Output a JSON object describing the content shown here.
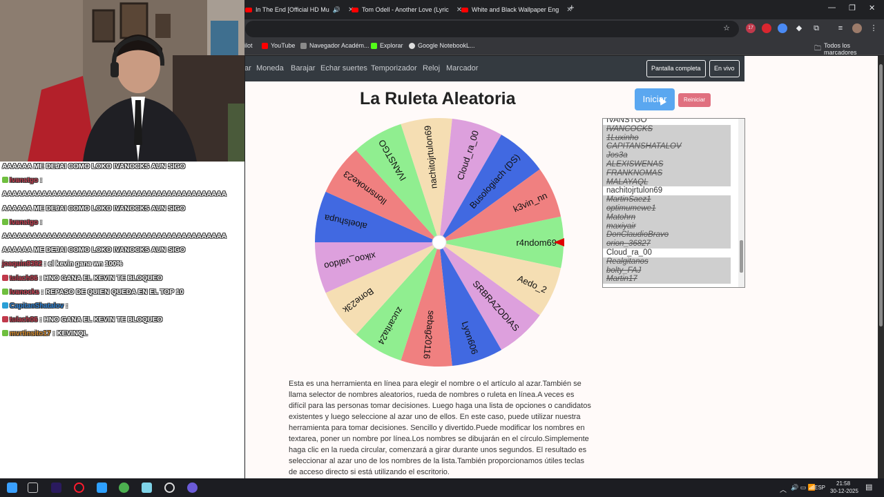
{
  "browser": {
    "tabs": [
      {
        "title": "In The End [Official HD Mu"
      },
      {
        "title": "Tom Odell - Another Love (Lyric"
      },
      {
        "title": "White and Black Wallpaper Eng"
      }
    ],
    "new_tab": "+",
    "window_controls": {
      "minimize": "—",
      "restore": "❐",
      "close": "✕"
    },
    "extension_badge": "17",
    "bookmarks": [
      {
        "label": "ilot"
      },
      {
        "label": "YouTube"
      },
      {
        "label": "Navegador Académ..."
      },
      {
        "label": "Explorar"
      },
      {
        "label": "Google NotebookL..."
      }
    ],
    "all_bookmarks": "Todos los marcadores"
  },
  "navbar": {
    "links": [
      "ar",
      "Moneda",
      "Barajar",
      "Echar suertes",
      "Temporizador",
      "Reloj",
      "Marcador"
    ],
    "fullscreen": "Pantalla completa",
    "live": "En vivo"
  },
  "page": {
    "title": "La Ruleta Aleatoria",
    "start_label": "Iniciar",
    "reset_label": "Reiniciar",
    "description": "Esta es una herramienta en línea para elegir el nombre o el artículo al azar.También se llama selector de nombres aleatorios, rueda de nombres o ruleta en línea.A veces es difícil para las personas tomar decisiones. Luego haga una lista de opciones o candidatos existentes y luego seleccione al azar uno de ellos. En este caso, puede utilizar nuestra herramienta para tomar decisiones. Sencillo y divertido.Puede modificar los nombres en textarea, poner un nombre por línea.Los nombres se dibujarán en el círculo.Simplemente haga clic en la rueda circular, comenzará a girar durante unos segundos. El resultado es seleccionar al azar uno de los nombres de la lista.También proporcionamos útiles teclas de acceso directo si está utilizando el escritorio."
  },
  "wheel": {
    "segments": [
      {
        "name": "r4ndom69",
        "color": "#90ee90"
      },
      {
        "name": "Aedo_2",
        "color": "#f5deb3"
      },
      {
        "name": "SRBRAZODIAS",
        "color": "#dda0dd"
      },
      {
        "name": "Lyon606",
        "color": "#4169e1"
      },
      {
        "name": "sebag20116",
        "color": "#f08080"
      },
      {
        "name": "zucarita24",
        "color": "#90ee90"
      },
      {
        "name": "Bone23k",
        "color": "#f5deb3"
      },
      {
        "name": "xikoo_valdoo",
        "color": "#dda0dd"
      },
      {
        "name": "aloelshupa",
        "color": "#4169e1"
      },
      {
        "name": "Ilonsmoke23",
        "color": "#f08080"
      },
      {
        "name": "IVANSTGO",
        "color": "#90ee90"
      },
      {
        "name": "nachitojrtulon69",
        "color": "#f5deb3"
      },
      {
        "name": "Cloud_ra_00",
        "color": "#dda0dd"
      },
      {
        "name": "Busologiach (DS)",
        "color": "#4169e1"
      },
      {
        "name": "k3vin_nn",
        "color": "#f08080"
      }
    ],
    "pointer_color": "#e00000"
  },
  "names_list": [
    {
      "text": "IVANSTGO",
      "off": false
    },
    {
      "text": "IVANCOCKS",
      "off": true
    },
    {
      "text": "1Luxinho",
      "off": true
    },
    {
      "text": "CAPITANSHATALOV",
      "off": true
    },
    {
      "text": "Jos3a",
      "off": true
    },
    {
      "text": "ALEXISWENAS",
      "off": true
    },
    {
      "text": "FRANKNOMAS",
      "off": true
    },
    {
      "text": "MALAYAQL",
      "off": true
    },
    {
      "text": "nachitojrtulon69",
      "off": false
    },
    {
      "text": "MartinSaez1",
      "off": true
    },
    {
      "text": "optimumewe1",
      "off": true
    },
    {
      "text": "Matohrn",
      "off": true
    },
    {
      "text": "maxiyair",
      "off": true
    },
    {
      "text": "DonClaudioBravo",
      "off": true
    },
    {
      "text": "orion_36827",
      "off": true
    },
    {
      "text": "Cloud_ra_00",
      "off": false
    },
    {
      "text": "Realgitanos",
      "off": true
    },
    {
      "text": "bolty_FAJ",
      "off": true
    },
    {
      "text": "Martin17",
      "off": true
    }
  ],
  "chat": [
    {
      "user": "",
      "text": "AAAAAA ME DEJAI COMO LOKO IVANOCKS AUN SIGO",
      "color": "white"
    },
    {
      "user": "Ivanstgo",
      "text": ":",
      "color": "red",
      "badge": "#6fbf3f"
    },
    {
      "user": "",
      "text": "AAAAAAAAAAAAAAAAAAAAAAAAAAAAAAAAAAAAAAAAAAAAA",
      "color": "white"
    },
    {
      "user": "",
      "text": "AAAAAA ME DEJAI COMO LOKO IVANOCKS AUN SIGO",
      "color": "white"
    },
    {
      "user": "Ivanstgo",
      "text": ":",
      "color": "red",
      "badge": "#6fbf3f"
    },
    {
      "user": "",
      "text": "AAAAAAAAAAAAAAAAAAAAAAAAAAAAAAAAAAAAAAAAAAAAA",
      "color": "white"
    },
    {
      "user": "",
      "text": "AAAAAA ME DEJAI COMO LOKO IVANOCKS AUN SIGO",
      "color": "white"
    },
    {
      "user": "joaquin9392",
      "text": ": el kevin gana wn 100%",
      "color": "red",
      "badge": ""
    },
    {
      "user": "tulach06",
      "text": ": HNO GANA EL KEVIN TE BLOQUEO",
      "color": "red",
      "badge": "#c0394b"
    },
    {
      "user": "Ivanocks",
      "text": ": REPASO DE QUIEN QUEDA EN EL TOP 10",
      "color": "red",
      "badge": "#6fbf3f"
    },
    {
      "user": "CapitanShatalov",
      "text": ":",
      "color": "blue",
      "badge": "#2a9fd6"
    },
    {
      "user": "tulach06",
      "text": ": HNO GANA EL KEVIN TE BLOQUEO",
      "color": "red",
      "badge": "#c0394b"
    },
    {
      "user": "mvrtinsito17",
      "text": ": KEVINQL",
      "color": "orange",
      "badge": "#6fbf3f"
    }
  ],
  "taskbar": {
    "lang": "ESP",
    "time": "21:58",
    "date": "30-12-2025"
  }
}
